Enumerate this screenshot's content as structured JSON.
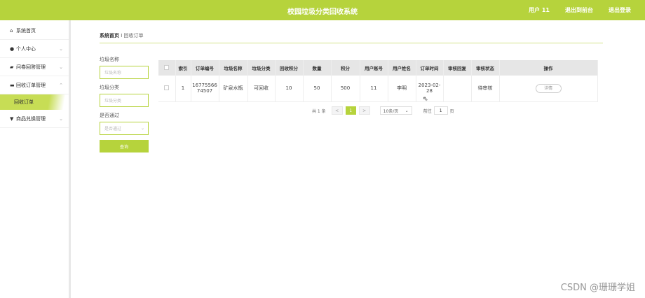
{
  "header": {
    "title": "校园垃圾分类回收系统",
    "user": "用户 11",
    "to_frontend": "退出到前台",
    "logout": "退出登录"
  },
  "sidebar": {
    "items": [
      {
        "label": "系统首页",
        "icon": "home-icon"
      },
      {
        "label": "个人中心",
        "icon": "user-icon"
      },
      {
        "label": "问卷回答管理",
        "icon": "survey-icon"
      },
      {
        "label": "回收订单管理",
        "icon": "order-icon"
      },
      {
        "label": "回收订单",
        "icon": ""
      },
      {
        "label": "商品兑换管理",
        "icon": "gift-icon"
      }
    ]
  },
  "breadcrumb": {
    "home": "系统首页",
    "current": "回收订单"
  },
  "filters": {
    "name_label": "垃圾名称",
    "name_placeholder": "垃圾名称",
    "category_label": "垃圾分类",
    "category_placeholder": "垃圾分类",
    "passed_label": "是否通过",
    "passed_placeholder": "是否通过",
    "search_button": "查询"
  },
  "table": {
    "headers": [
      "索引",
      "订单编号",
      "垃圾名称",
      "垃圾分类",
      "回收积分",
      "数量",
      "积分",
      "用户账号",
      "用户姓名",
      "订单时间",
      "审核回复",
      "审核状态",
      "操作"
    ],
    "rows": [
      {
        "index": "1",
        "order_no": "1677556674507",
        "order_no_l1": "16775566",
        "order_no_l2": "74507",
        "name": "矿泉水瓶",
        "category": "可回收",
        "recycle_points": "10",
        "quantity": "50",
        "points": "500",
        "account": "11",
        "user_name": "李明",
        "time_l1": "2023-02-",
        "time_l2": "28",
        "reply": "",
        "status": "待审核",
        "action": "详情"
      }
    ]
  },
  "pager": {
    "total": "共 1 条",
    "prev": "<",
    "page": "1",
    "next": ">",
    "size": "10条/页",
    "goto": "前往",
    "goto_value": "1",
    "page_suffix": "页"
  },
  "watermark": "CSDN @珊珊学姐"
}
